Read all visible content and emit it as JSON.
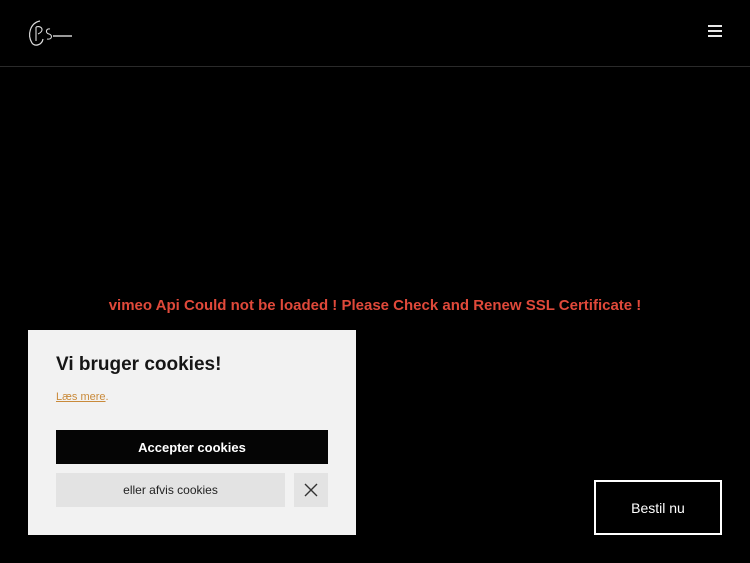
{
  "header": {
    "logo_icon": "ps-logo",
    "menu_icon": "hamburger-menu-icon"
  },
  "video": {
    "error_message": "vimeo Api Could not be loaded ! Please Check and Renew SSL Certificate !"
  },
  "cookie_banner": {
    "title": "Vi bruger cookies!",
    "read_more_label": "Læs mere",
    "read_more_suffix": ".",
    "accept_label": "Accepter cookies",
    "decline_label": "eller afvis cookies",
    "close_icon": "close-icon"
  },
  "cta": {
    "order_label": "Bestil nu"
  },
  "colors": {
    "background": "#000000",
    "error": "#e0493a",
    "panel": "#f2f2f2",
    "link": "#c98a3a"
  }
}
